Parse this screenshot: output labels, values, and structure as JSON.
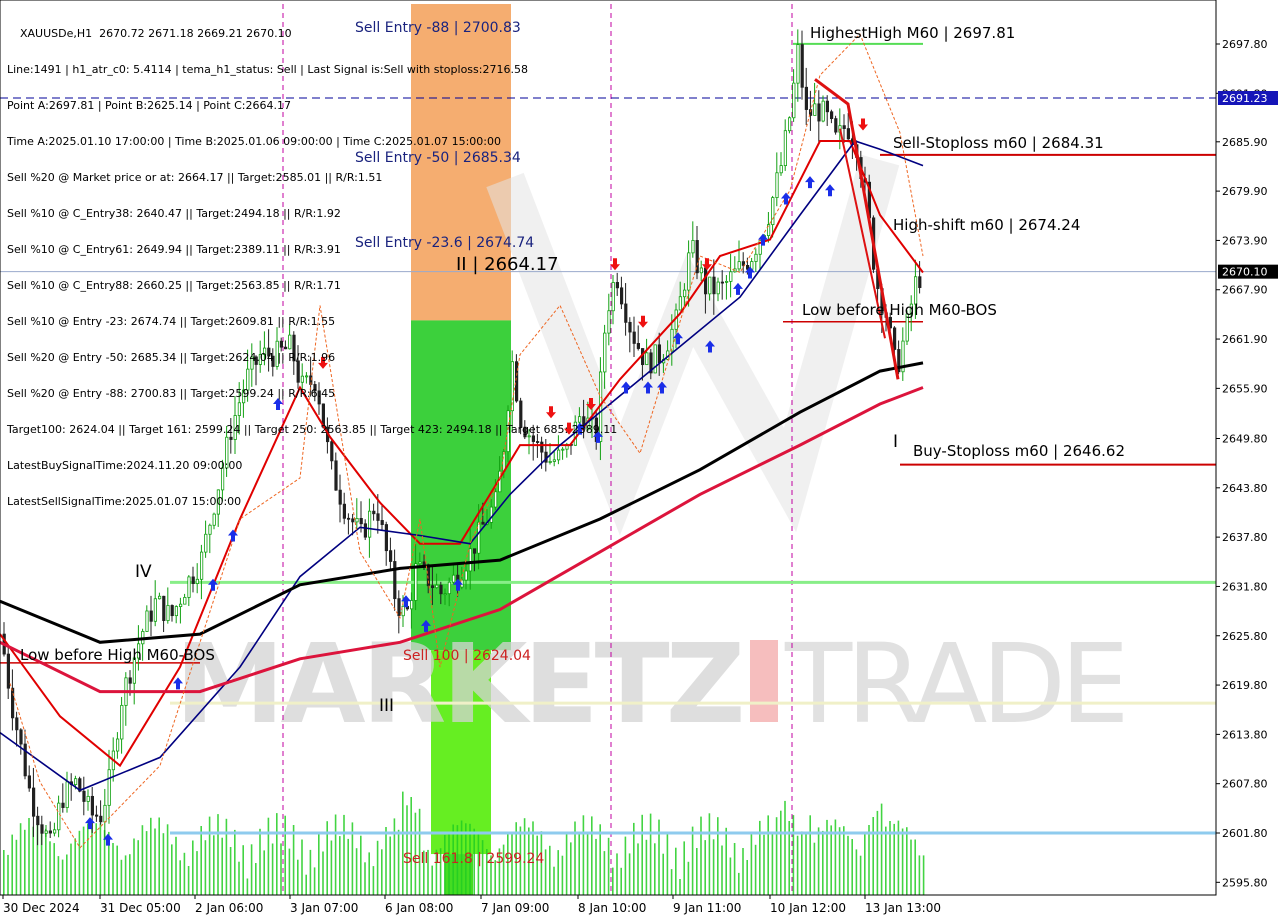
{
  "header": {
    "symbol": "XAUUSDe,H1",
    "ohlc": "2670.72 2671.18 2669.21 2670.10",
    "info_lines": [
      "Line:1491 | h1_atr_c0: 5.4114 | tema_h1_status: Sell | Last Signal is:Sell with stoploss:2716.58",
      "Point A:2697.81 | Point B:2625.14 | Point C:2664.17",
      "Time A:2025.01.10 17:00:00 | Time B:2025.01.06 09:00:00 | Time C:2025.01.07 15:00:00",
      "Sell %20 @ Market price or at: 2664.17 || Target:2585.01 || R/R:1.51",
      "Sell %10 @ C_Entry38: 2640.47 || Target:2494.18 || R/R:1.92",
      "Sell %10 @ C_Entry61: 2649.94 || Target:2389.11 || R/R:3.91",
      "Sell %10 @ C_Entry88: 2660.25 || Target:2563.85 || R/R:1.71",
      "Sell %10 @ Entry -23: 2674.74 || Target:2609.81 || R/R:1.55",
      "Sell %20 @ Entry -50: 2685.34 || Target:2624.04 || R/R:1.96",
      "Sell %20 @ Entry -88: 2700.83 || Target:2599.24 || R/R:6.45",
      "Target100: 2624.04 || Target 161: 2599.24 || Target 250: 2563.85 || Target 423: 2494.18 || Target 685: 2389.11",
      "LatestBuySignalTime:2024.11.20 09:00:00",
      "LatestSellSignalTime:2025.01.07 15:00:00"
    ]
  },
  "watermark": {
    "left": "MARKETZ",
    "right": "TRADE"
  },
  "chart_labels": {
    "sell_entry_88": "Sell Entry -88 | 2700.83",
    "sell_entry_50": "Sell Entry -50 | 2685.34",
    "sell_entry_23": "Sell Entry -23.6 | 2674.74",
    "point_c": "II | 2664.17",
    "sell_100": "Sell 100 | 2624.04",
    "sell_161": "Sell 161.8 | 2599.24",
    "highest_high": "HighestHigh   M60 | 2697.81",
    "sell_stoploss": "Sell-Stoploss m60 | 2684.31",
    "high_shift": "High-shift m60 | 2674.24",
    "low_before_high_right": "Low before High   M60-BOS",
    "buy_stoploss": "Buy-Stoploss m60 | 2646.62",
    "low_before_high_left": "Low before High   M60-BOS",
    "wave_i": "I",
    "wave_iii": "III",
    "wave_iv": "IV"
  },
  "price_tags": {
    "blue_dashed": "2691.23",
    "current": "2670.10"
  },
  "colors": {
    "bull": "#10a010",
    "bear": "#202020",
    "red_ma": "#e00000",
    "navy_ma": "#000080",
    "black_ma": "#000000",
    "crimson_ma": "#dc143c",
    "sell_zone": "#f4a460",
    "buy_zone": "#32cd32",
    "volume": "#22cc22"
  },
  "chart_data": {
    "type": "candlestick",
    "title": "XAUUSDe,H1",
    "y_ticks": [
      2697.8,
      2691.8,
      2685.9,
      2679.9,
      2673.9,
      2667.9,
      2661.9,
      2655.9,
      2649.8,
      2643.8,
      2637.8,
      2631.8,
      2625.8,
      2619.8,
      2613.8,
      2607.8,
      2601.8,
      2595.8
    ],
    "x_ticks": [
      "30 Dec 2024",
      "31 Dec 05:00",
      "2 Jan 06:00",
      "3 Jan 07:00",
      "6 Jan 08:00",
      "7 Jan 09:00",
      "8 Jan 10:00",
      "9 Jan 11:00",
      "10 Jan 12:00",
      "13 Jan 13:00"
    ],
    "ylim": [
      2594.5,
      2701.0
    ],
    "key_points": {
      "point_a": 2697.81,
      "point_b": 2625.14,
      "point_c": 2664.17,
      "current_price": 2670.1
    },
    "levels": {
      "sell_entry_88": 2700.83,
      "sell_entry_50": 2685.34,
      "sell_entry_23": 2674.74,
      "sell_100": 2624.04,
      "sell_161": 2599.24,
      "sell_stoploss_m60": 2684.31,
      "high_shift_m60": 2674.24,
      "buy_stoploss_m60": 2646.62
    },
    "price_path_anchors": [
      [
        0,
        2626
      ],
      [
        10,
        2618
      ],
      [
        20,
        2612
      ],
      [
        30,
        2606
      ],
      [
        40,
        2603
      ],
      [
        50,
        2600
      ],
      [
        60,
        2606
      ],
      [
        75,
        2608
      ],
      [
        90,
        2604
      ],
      [
        100,
        2604
      ],
      [
        110,
        2609
      ],
      [
        120,
        2618
      ],
      [
        130,
        2622
      ],
      [
        140,
        2626
      ],
      [
        155,
        2630
      ],
      [
        170,
        2628
      ],
      [
        185,
        2632
      ],
      [
        200,
        2635
      ],
      [
        215,
        2643
      ],
      [
        230,
        2651
      ],
      [
        245,
        2657
      ],
      [
        260,
        2660
      ],
      [
        275,
        2660
      ],
      [
        290,
        2661
      ],
      [
        300,
        2656
      ],
      [
        315,
        2657
      ],
      [
        330,
        2646
      ],
      [
        345,
        2641
      ],
      [
        360,
        2638
      ],
      [
        375,
        2642
      ],
      [
        385,
        2636
      ],
      [
        395,
        2630
      ],
      [
        405,
        2628
      ],
      [
        415,
        2634
      ],
      [
        425,
        2633
      ],
      [
        440,
        2631
      ],
      [
        455,
        2633
      ],
      [
        470,
        2636
      ],
      [
        485,
        2640
      ],
      [
        495,
        2642
      ],
      [
        505,
        2651
      ],
      [
        510,
        2660
      ],
      [
        520,
        2652
      ],
      [
        535,
        2649
      ],
      [
        550,
        2647
      ],
      [
        565,
        2648
      ],
      [
        580,
        2653
      ],
      [
        595,
        2650
      ],
      [
        605,
        2665
      ],
      [
        615,
        2670
      ],
      [
        630,
        2663
      ],
      [
        645,
        2659
      ],
      [
        660,
        2660
      ],
      [
        675,
        2664
      ],
      [
        690,
        2673
      ],
      [
        705,
        2668
      ],
      [
        720,
        2668
      ],
      [
        735,
        2670
      ],
      [
        750,
        2672
      ],
      [
        765,
        2676
      ],
      [
        780,
        2683
      ],
      [
        790,
        2690
      ],
      [
        797,
        2697
      ],
      [
        805,
        2689
      ],
      [
        815,
        2690
      ],
      [
        825,
        2689
      ],
      [
        835,
        2686
      ],
      [
        845,
        2688
      ],
      [
        855,
        2686
      ],
      [
        865,
        2679
      ],
      [
        875,
        2669
      ],
      [
        885,
        2665
      ],
      [
        895,
        2658
      ],
      [
        905,
        2663
      ],
      [
        915,
        2669
      ],
      [
        923,
        2670
      ]
    ],
    "moving_averages": [
      {
        "name": "red",
        "values": [
          [
            0,
            2626
          ],
          [
            60,
            2616
          ],
          [
            120,
            2610
          ],
          [
            180,
            2622
          ],
          [
            240,
            2640
          ],
          [
            300,
            2656
          ],
          [
            330,
            2650
          ],
          [
            380,
            2642
          ],
          [
            420,
            2637
          ],
          [
            460,
            2637
          ],
          [
            520,
            2649
          ],
          [
            570,
            2649
          ],
          [
            620,
            2657
          ],
          [
            680,
            2665
          ],
          [
            720,
            2672
          ],
          [
            770,
            2674
          ],
          [
            820,
            2686
          ],
          [
            850,
            2686
          ],
          [
            880,
            2677
          ],
          [
            923,
            2670
          ]
        ]
      },
      {
        "name": "navy",
        "values": [
          [
            0,
            2614
          ],
          [
            80,
            2607
          ],
          [
            160,
            2611
          ],
          [
            240,
            2622
          ],
          [
            300,
            2633
          ],
          [
            360,
            2639
          ],
          [
            420,
            2638
          ],
          [
            470,
            2637
          ],
          [
            510,
            2643
          ],
          [
            560,
            2649
          ],
          [
            620,
            2655
          ],
          [
            680,
            2661
          ],
          [
            740,
            2667
          ],
          [
            800,
            2677
          ],
          [
            855,
            2686
          ],
          [
            880,
            2685
          ],
          [
            923,
            2683
          ]
        ]
      },
      {
        "name": "black",
        "values": [
          [
            0,
            2630
          ],
          [
            100,
            2625
          ],
          [
            200,
            2626
          ],
          [
            300,
            2632
          ],
          [
            400,
            2634
          ],
          [
            500,
            2635
          ],
          [
            600,
            2640
          ],
          [
            700,
            2646
          ],
          [
            800,
            2653
          ],
          [
            880,
            2658
          ],
          [
            923,
            2659
          ]
        ]
      },
      {
        "name": "crimson",
        "values": [
          [
            0,
            2625
          ],
          [
            100,
            2619
          ],
          [
            200,
            2619
          ],
          [
            300,
            2623
          ],
          [
            400,
            2625
          ],
          [
            500,
            2629
          ],
          [
            600,
            2636
          ],
          [
            700,
            2643
          ],
          [
            800,
            2649
          ],
          [
            880,
            2654
          ],
          [
            923,
            2656
          ]
        ]
      }
    ]
  }
}
